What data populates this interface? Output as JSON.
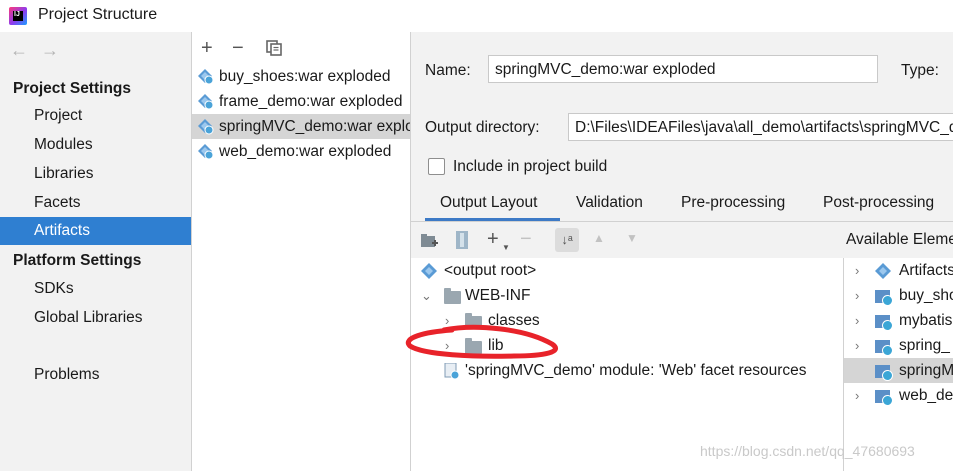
{
  "window": {
    "title": "Project Structure"
  },
  "nav": {
    "back_icon": "arrow-left-icon",
    "forward_icon": "arrow-right-icon",
    "sections": [
      {
        "heading": "Project Settings",
        "items": [
          "Project",
          "Modules",
          "Libraries",
          "Facets",
          "Artifacts"
        ]
      },
      {
        "heading": "Platform Settings",
        "items": [
          "SDKs",
          "Global Libraries"
        ]
      }
    ],
    "problems": "Problems",
    "selected": "Artifacts"
  },
  "artifacts": {
    "toolbar": {
      "add": "+",
      "remove": "−",
      "copy_icon": "copy-icon"
    },
    "items": [
      "buy_shoes:war exploded",
      "frame_demo:war exploded",
      "springMVC_demo:war exploded",
      "web_demo:war exploded"
    ],
    "selected_index": 2
  },
  "detail": {
    "name_label": "Name:",
    "name_value": "springMVC_demo:war exploded",
    "type_label": "Type:",
    "output_dir_label": "Output directory:",
    "output_dir_value": "D:\\Files\\IDEAFiles\\java\\all_demo\\artifacts\\springMVC_demo",
    "include_build_label": "Include in project build",
    "include_build_checked": false,
    "tabs": [
      "Output Layout",
      "Validation",
      "Pre-processing",
      "Post-processing"
    ],
    "active_tab": "Output Layout"
  },
  "layout_tree": {
    "rows": [
      {
        "label": "<output root>",
        "icon": "output-root-icon",
        "expanded": null
      },
      {
        "label": "WEB-INF",
        "icon": "folder-icon",
        "expanded": true
      },
      {
        "label": "classes",
        "icon": "folder-icon",
        "expanded": false
      },
      {
        "label": "lib",
        "icon": "folder-icon",
        "expanded": false
      },
      {
        "label": "'springMVC_demo' module: 'Web' facet resources",
        "icon": "web-facet-icon",
        "expanded": null
      }
    ]
  },
  "available": {
    "header": "Available Elements",
    "items": [
      "Artifacts",
      "buy_shoes",
      "mybatis",
      "spring_",
      "springMVC",
      "web_demo"
    ],
    "selected_index": 4
  },
  "annotation": {
    "color": "#e8232a"
  },
  "watermark": "https://blog.csdn.net/qq_47680693",
  "colors": {
    "selection": "#2f7fd1",
    "tab_underline": "#3d7ac6"
  }
}
